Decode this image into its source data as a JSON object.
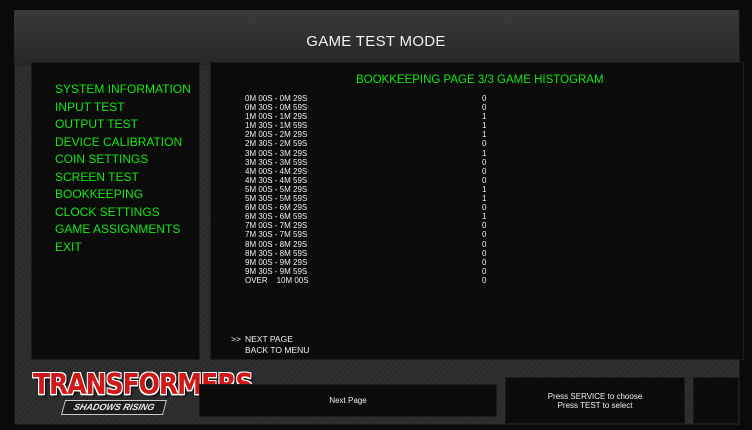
{
  "title": "GAME TEST MODE",
  "menu": {
    "items": [
      "SYSTEM INFORMATION",
      "INPUT TEST",
      "OUTPUT TEST",
      "DEVICE CALIBRATION",
      "COIN SETTINGS",
      "SCREEN TEST",
      "BOOKKEEPING",
      "CLOCK SETTINGS",
      "GAME ASSIGNMENTS",
      "EXIT"
    ]
  },
  "content": {
    "title": "BOOKKEEPING PAGE 3/3 GAME HISTOGRAM",
    "rows": [
      {
        "label": "0M 00S - 0M 29S",
        "value": "0"
      },
      {
        "label": "0M 30S - 0M 59S",
        "value": "0"
      },
      {
        "label": "1M 00S - 1M 29S",
        "value": "1"
      },
      {
        "label": "1M 30S - 1M 59S",
        "value": "1"
      },
      {
        "label": "2M 00S - 2M 29S",
        "value": "1"
      },
      {
        "label": "2M 30S - 2M 59S",
        "value": "0"
      },
      {
        "label": "3M 00S - 3M 29S",
        "value": "1"
      },
      {
        "label": "3M 30S - 3M 59S",
        "value": "0"
      },
      {
        "label": "4M 00S - 4M 29S",
        "value": "0"
      },
      {
        "label": "4M 30S - 4M 59S",
        "value": "0"
      },
      {
        "label": "5M 00S - 5M 29S",
        "value": "1"
      },
      {
        "label": "5M 30S - 5M 59S",
        "value": "1"
      },
      {
        "label": "6M 00S - 6M 29S",
        "value": "0"
      },
      {
        "label": "6M 30S - 6M 59S",
        "value": "1"
      },
      {
        "label": "7M 00S - 7M 29S",
        "value": "0"
      },
      {
        "label": "7M 30S - 7M 59S",
        "value": "0"
      },
      {
        "label": "8M 00S - 8M 29S",
        "value": "0"
      },
      {
        "label": "8M 30S - 8M 59S",
        "value": "0"
      },
      {
        "label": "9M 00S - 9M 29S",
        "value": "0"
      },
      {
        "label": "9M 30S - 9M 59S",
        "value": "0"
      },
      {
        "label": "OVER    10M 00S",
        "value": "0"
      }
    ],
    "nav": {
      "cursor": ">>",
      "next_page": "NEXT PAGE",
      "back_to_menu": "BACK TO MENU"
    }
  },
  "logo": {
    "main": "TRANSFORMERS",
    "sub": "SHADOWS RISING",
    "main_color": "#d01818"
  },
  "footer": {
    "hint": "Next Page",
    "instructions": [
      "Press SERVICE to choose",
      "Press TEST to select"
    ]
  },
  "colors": {
    "menu_text": "#14e814",
    "body_text": "#f0f0f0"
  }
}
